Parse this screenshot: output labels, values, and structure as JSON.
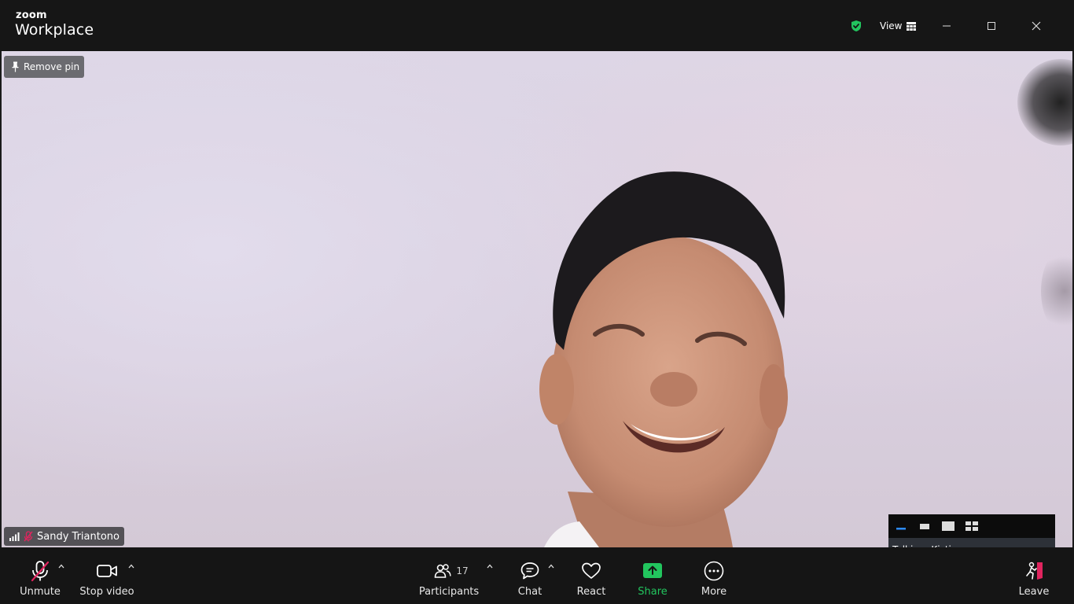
{
  "titlebar": {
    "logo_small": "zoom",
    "logo_big": "Workplace",
    "view_label": "View",
    "shield_color": "#22c55e"
  },
  "video": {
    "remove_pin_label": "Remove pin",
    "participant_name": "Sandy Triantono"
  },
  "mini_panel": {
    "talking_label": "Talking: Kistiawan"
  },
  "toolbar": {
    "unmute_label": "Unmute",
    "stop_video_label": "Stop video",
    "participants_label": "Participants",
    "participants_count": "17",
    "chat_label": "Chat",
    "react_label": "React",
    "share_label": "Share",
    "more_label": "More",
    "leave_label": "Leave",
    "share_color": "#22c55e",
    "muted_color": "#e0245e"
  }
}
